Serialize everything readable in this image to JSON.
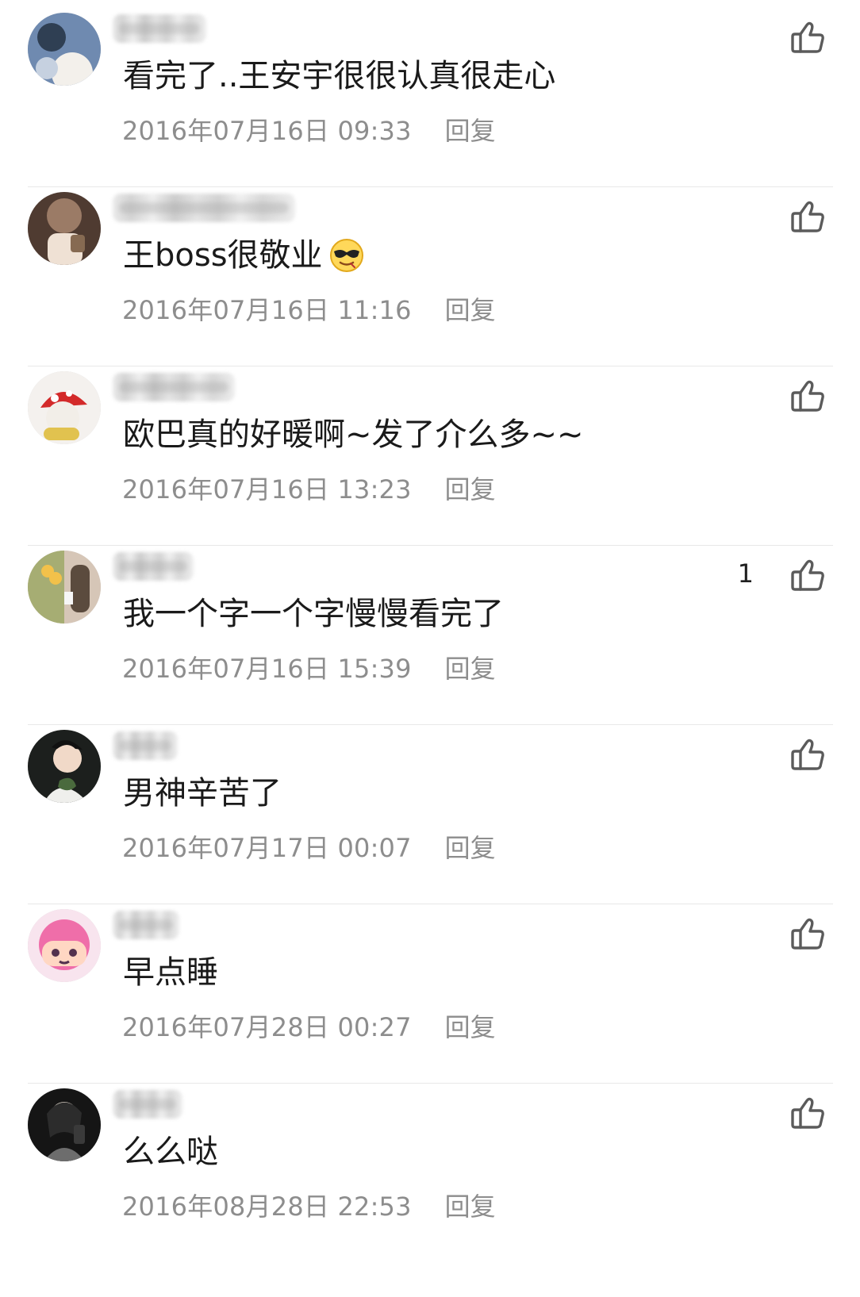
{
  "comments": [
    {
      "avatar_name": "avatar-portrait-dog-icon",
      "avatar_colors": [
        "#6f8ab0",
        "#f3f0eb",
        "#2f3f53"
      ],
      "text": "看完了..王安宇很很认真很走心",
      "emoji": "",
      "time": "2016年07月16日 09:33",
      "reply": "回复",
      "likes": "",
      "like_icon": "thumb-up-icon"
    },
    {
      "avatar_name": "avatar-woman-bag-icon",
      "avatar_colors": [
        "#4f3b31",
        "#efe1d4",
        "#9b7b66"
      ],
      "text": "王boss很敬业",
      "emoji": "sunglasses-emoji",
      "time": "2016年07月16日 11:16",
      "reply": "回复",
      "likes": "",
      "like_icon": "thumb-up-icon"
    },
    {
      "avatar_name": "avatar-mushroom-doll-icon",
      "avatar_colors": [
        "#d32a2a",
        "#f2eee8",
        "#e1c24f"
      ],
      "text": "欧巴真的好暖啊~发了介么多~~",
      "emoji": "",
      "time": "2016年07月16日 13:23",
      "reply": "回复",
      "likes": "",
      "like_icon": "thumb-up-icon"
    },
    {
      "avatar_name": "avatar-flowers-phone-icon",
      "avatar_colors": [
        "#a6ad73",
        "#f2c14a",
        "#d6c6b7"
      ],
      "text": "我一个字一个字慢慢看完了",
      "emoji": "",
      "time": "2016年07月16日 15:39",
      "reply": "回复",
      "likes": "1",
      "like_icon": "thumb-up-icon"
    },
    {
      "avatar_name": "avatar-man-flowers-icon",
      "avatar_colors": [
        "#1c1f1d",
        "#efefec",
        "#4a6a3d"
      ],
      "text": "男神辛苦了",
      "emoji": "",
      "time": "2016年07月17日 00:07",
      "reply": "回复",
      "likes": "",
      "like_icon": "thumb-up-icon"
    },
    {
      "avatar_name": "avatar-pink-cartoon-icon",
      "avatar_colors": [
        "#ef6ea9",
        "#ffd7c3",
        "#53324e"
      ],
      "text": "早点睡",
      "emoji": "",
      "time": "2016年07月28日 00:27",
      "reply": "回复",
      "likes": "",
      "like_icon": "thumb-up-icon"
    },
    {
      "avatar_name": "avatar-dark-portrait-icon",
      "avatar_colors": [
        "#151515",
        "#dcd3c8",
        "#6d6d6d"
      ],
      "text": "么么哒",
      "emoji": "",
      "time": "2016年08月28日 22:53",
      "reply": "回复",
      "likes": "",
      "like_icon": "thumb-up-icon"
    }
  ]
}
